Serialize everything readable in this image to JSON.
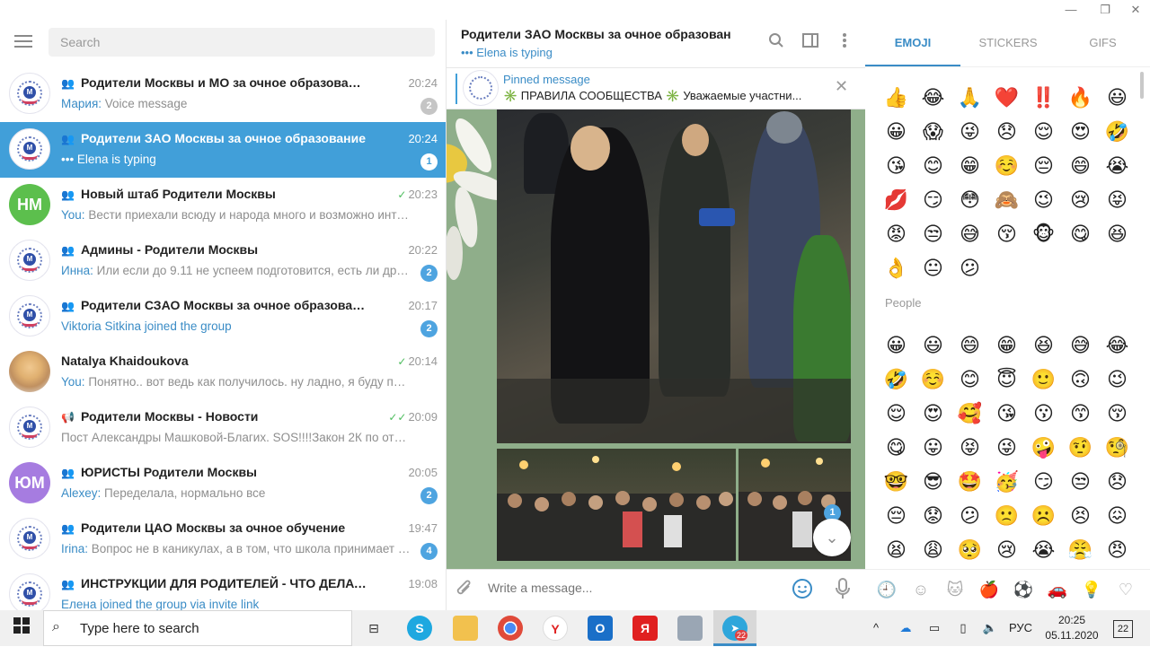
{
  "window": {
    "controls": [
      "—",
      "❐",
      "✕"
    ]
  },
  "sidebar": {
    "search_placeholder": "Search",
    "chats": [
      {
        "title": "Родители Москвы и МО за очное образование",
        "time": "20:24",
        "sender": "Мария:",
        "message": "Voice message",
        "badge": "2",
        "badge_muted": true,
        "avatar": "logo",
        "type_icon": "group"
      },
      {
        "title": "Родители ЗАО Москвы за очное образование",
        "time": "20:24",
        "sender": "",
        "message": "••• Elena is typing",
        "badge": "1",
        "badge_muted": false,
        "avatar": "logo",
        "type_icon": "group",
        "active": true
      },
      {
        "title": "Новый штаб Родители Москвы",
        "time": "20:23",
        "sender": "You:",
        "message": "Вести приехали всюду и народа много и возможно интерв...",
        "badge": "",
        "avatar": "initials",
        "initials": "НМ",
        "avatar_color": "#5cbf4d",
        "type_icon": "group",
        "check": "✓"
      },
      {
        "title": "Админы - Родители Москвы",
        "time": "20:22",
        "sender": "Инна:",
        "message": "Или если до 9.11 не успеем подготовится,  есть ли друг...",
        "badge": "2",
        "badge_muted": false,
        "avatar": "logo",
        "type_icon": "group"
      },
      {
        "title": "Родители СЗАО Москвы за очное образование",
        "time": "20:17",
        "sender": "Viktoria Sitkina joined the group",
        "message": "",
        "badge": "2",
        "badge_muted": false,
        "avatar": "logo",
        "type_icon": "group"
      },
      {
        "title": "Natalya Khaidoukova",
        "time": "20:14",
        "sender": "You:",
        "message": "Понятно.. вот ведь как получилось. ну ладно, я буду просить...",
        "badge": "",
        "avatar": "photo",
        "type_icon": "",
        "check": "✓"
      },
      {
        "title": "Родители Москвы - Новости",
        "time": "20:09",
        "sender": "",
        "message": "Пост Александры Машковой-Благих. SOS!!!!Закон 2К по отбрани...",
        "badge": "",
        "avatar": "logo",
        "type_icon": "channel",
        "check": "✓✓"
      },
      {
        "title": "ЮРИСТЫ Родители Москвы",
        "time": "20:05",
        "sender": "Alexey:",
        "message": "Переделала, нормально все",
        "badge": "2",
        "badge_muted": false,
        "avatar": "initials",
        "initials": "ЮМ",
        "avatar_color": "#a67ce0",
        "type_icon": "group"
      },
      {
        "title": "Родители ЦАО Москвы за очное обучение",
        "time": "19:47",
        "sender": "Irina:",
        "message": "Вопрос не в каникулах, а в том, что школа принимает р...",
        "badge": "4",
        "badge_muted": false,
        "avatar": "logo",
        "type_icon": "group"
      },
      {
        "title": "ИНСТРУКЦИИ ДЛЯ РОДИТЕЛЕЙ - ЧТО ДЕЛАТЬ - обновл...",
        "time": "19:08",
        "sender": "Елена joined the group via invite link",
        "message": "",
        "badge": "",
        "avatar": "logo",
        "type_icon": "group"
      }
    ]
  },
  "chat": {
    "title": "Родители ЗАО Москвы за очное образован...",
    "status": "••• Elena is typing",
    "pinned_label": "Pinned message",
    "pinned_text": "✳️ ПРАВИЛА СООБЩЕСТВА ✳️  Уважаемые участни...",
    "scroll_badge": "1",
    "input_placeholder": "Write a message..."
  },
  "panel": {
    "tabs": [
      "EMOJI",
      "STICKERS",
      "GIFS"
    ],
    "recent": [
      "👍",
      "😂",
      "🙏",
      "❤️",
      "‼️",
      "🔥",
      "😃",
      "😀",
      "😱",
      "😜",
      "😞",
      "😌",
      "😍",
      "🤣",
      "😘",
      "😊",
      "😁",
      "☺️",
      "😔",
      "😄",
      "😭",
      "💋",
      "😏",
      "😳",
      "🙈",
      "😉",
      "😢",
      "😝",
      "😡",
      "😒",
      "😅",
      "😚",
      "🐵",
      "😋",
      "😆",
      "👌",
      "😐",
      "😕"
    ],
    "people_label": "People",
    "people": [
      "😀",
      "😃",
      "😄",
      "😁",
      "😆",
      "😅",
      "😂",
      "🤣",
      "☺️",
      "😊",
      "😇",
      "🙂",
      "🙃",
      "😉",
      "😌",
      "😍",
      "🥰",
      "😘",
      "😗",
      "😙",
      "😚",
      "😋",
      "😛",
      "😝",
      "😜",
      "🤪",
      "🤨",
      "🧐",
      "🤓",
      "😎",
      "🤩",
      "🥳",
      "😏",
      "😒",
      "😞",
      "😔",
      "😟",
      "😕",
      "🙁",
      "☹️",
      "😣",
      "😖",
      "😫",
      "😩",
      "🥺",
      "😢",
      "😭",
      "😤",
      "😠"
    ],
    "categories": [
      "🕘",
      "☺",
      "🐱",
      "🍎",
      "⚽",
      "🚗",
      "💡",
      "♡"
    ]
  },
  "taskbar": {
    "search_text": "Type here to search",
    "lang": "РУС",
    "time": "20:25",
    "date": "05.11.2020",
    "telegram_badge": "22",
    "notif_count": "22"
  }
}
